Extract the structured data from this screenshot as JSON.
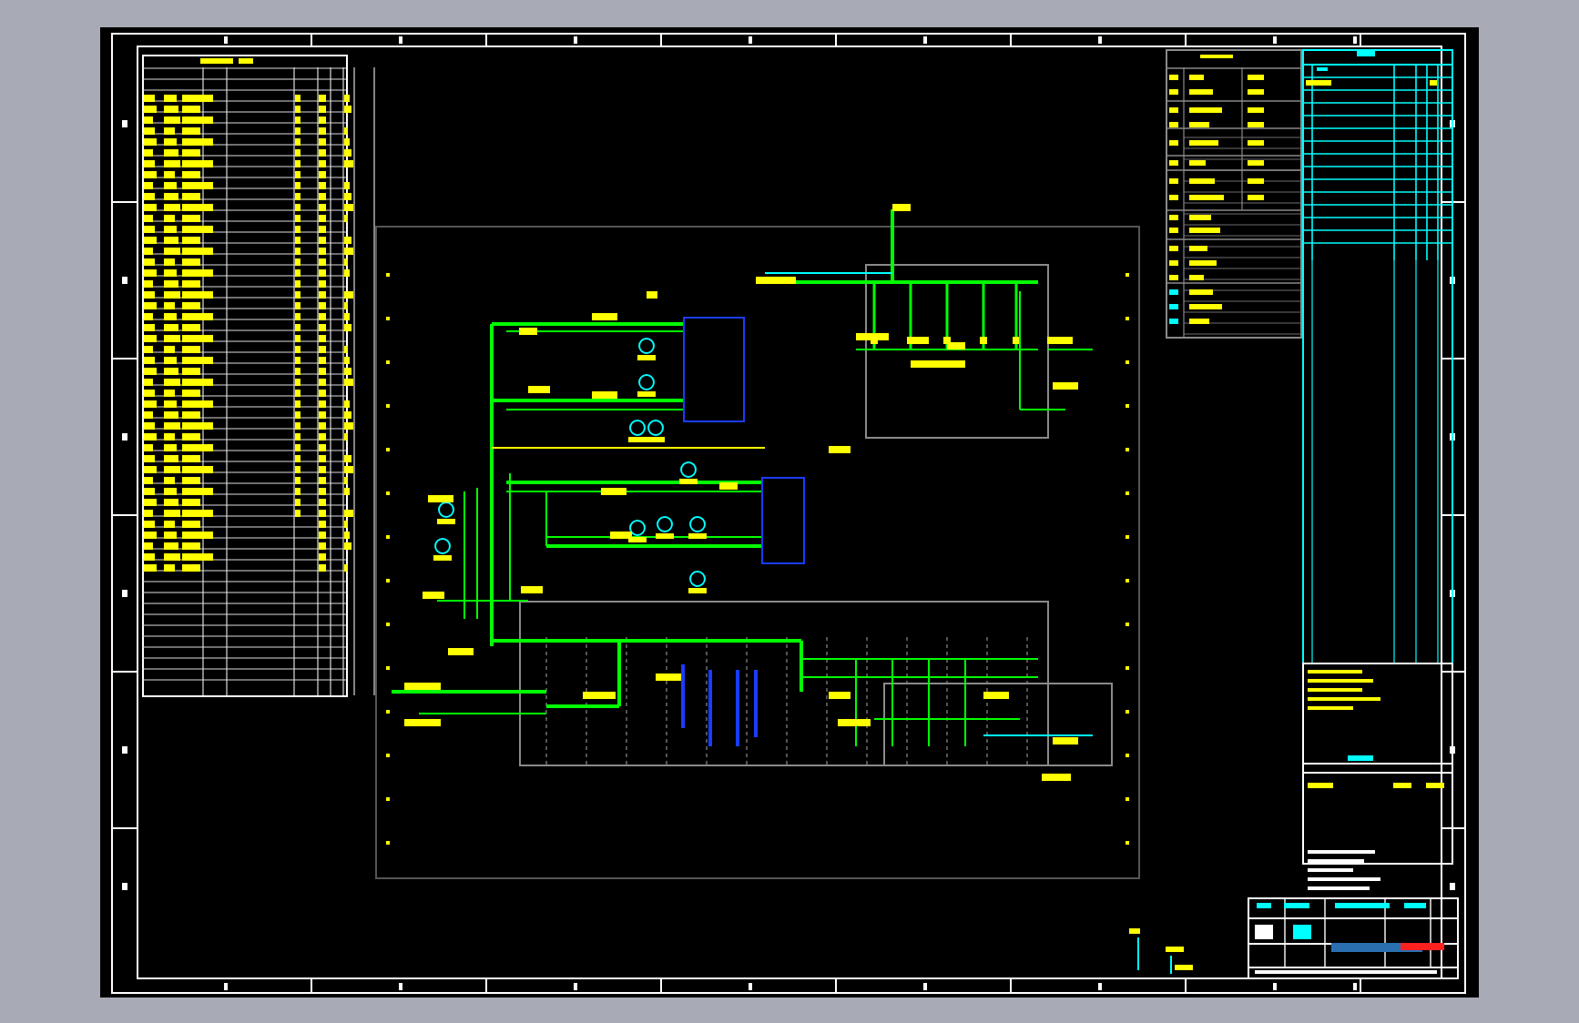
{
  "sheet": {
    "kind": "cad-drawing",
    "parts": [
      {
        "kind": "frame"
      },
      {
        "kind": "legend-table"
      },
      {
        "kind": "schematic"
      },
      {
        "kind": "spec-table"
      },
      {
        "kind": "revision-table"
      },
      {
        "kind": "notes-block"
      },
      {
        "kind": "title-block"
      }
    ]
  }
}
